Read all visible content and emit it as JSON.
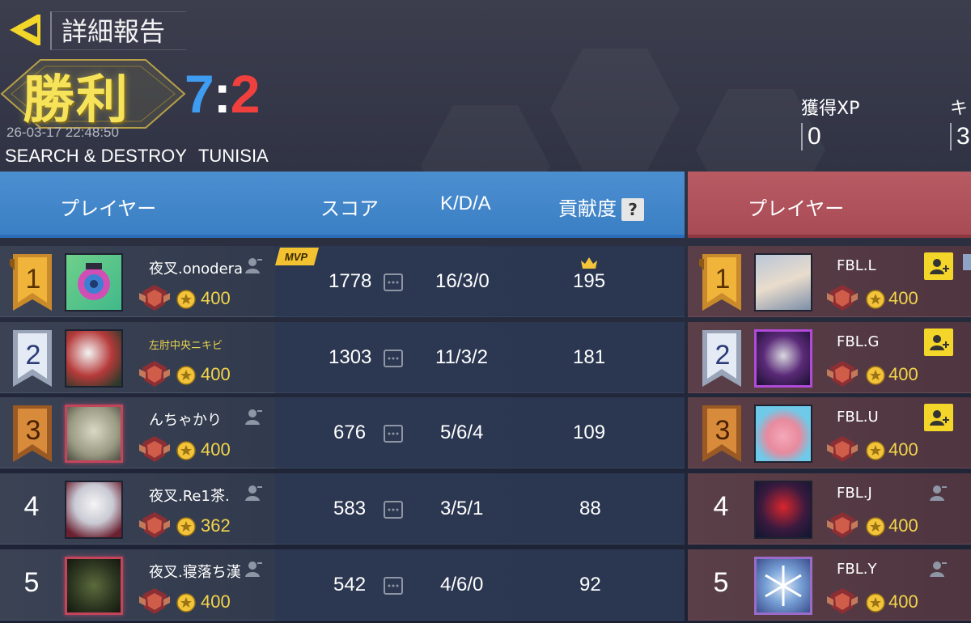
{
  "header": {
    "title": "詳細報告",
    "result": "勝利",
    "score_blue": "7",
    "score_sep": ":",
    "score_red": "2",
    "datetime": "26-03-17 22:48:50",
    "mode": "SEARCH & DESTROY",
    "map": "TUNISIA"
  },
  "stats": [
    {
      "label": "獲得XP",
      "value": "0"
    },
    {
      "label": "キ",
      "value": "3."
    }
  ],
  "columns_blue": {
    "player": "プレイヤー",
    "score": "スコア",
    "kda": "K/D/A",
    "contribution": "貢献度",
    "help": "?"
  },
  "columns_red": {
    "player": "プレイヤー"
  },
  "colors": {
    "blue": "#3e9cf1",
    "red": "#f0403e",
    "gold": "#f3d54c",
    "victory": "#f7e35a"
  },
  "badges": {
    "mvp": "MVP"
  },
  "blue_team": [
    {
      "rank": "1",
      "name": "夜叉.onodera",
      "level": "400",
      "score": "1778",
      "kda": "16/3/0",
      "contribution": "195"
    },
    {
      "rank": "2",
      "name": "左肘中央ニキビ",
      "level": "400",
      "score": "1303",
      "kda": "11/3/2",
      "contribution": "181"
    },
    {
      "rank": "3",
      "name": "んちゃかり",
      "level": "400",
      "score": "676",
      "kda": "5/6/4",
      "contribution": "109"
    },
    {
      "rank": "4",
      "name": "夜叉.Re1茶.",
      "level": "362",
      "score": "583",
      "kda": "3/5/1",
      "contribution": "88"
    },
    {
      "rank": "5",
      "name": "夜叉.寝落ち漢",
      "level": "400",
      "score": "542",
      "kda": "4/6/0",
      "contribution": "92"
    }
  ],
  "red_team": [
    {
      "rank": "1",
      "name": "FBL.L",
      "level": "400"
    },
    {
      "rank": "2",
      "name": "FBL.G",
      "level": "400"
    },
    {
      "rank": "3",
      "name": "FBL.U",
      "level": "400"
    },
    {
      "rank": "4",
      "name": "FBL.J",
      "level": "400"
    },
    {
      "rank": "5",
      "name": "FBL.Y",
      "level": "400"
    }
  ]
}
